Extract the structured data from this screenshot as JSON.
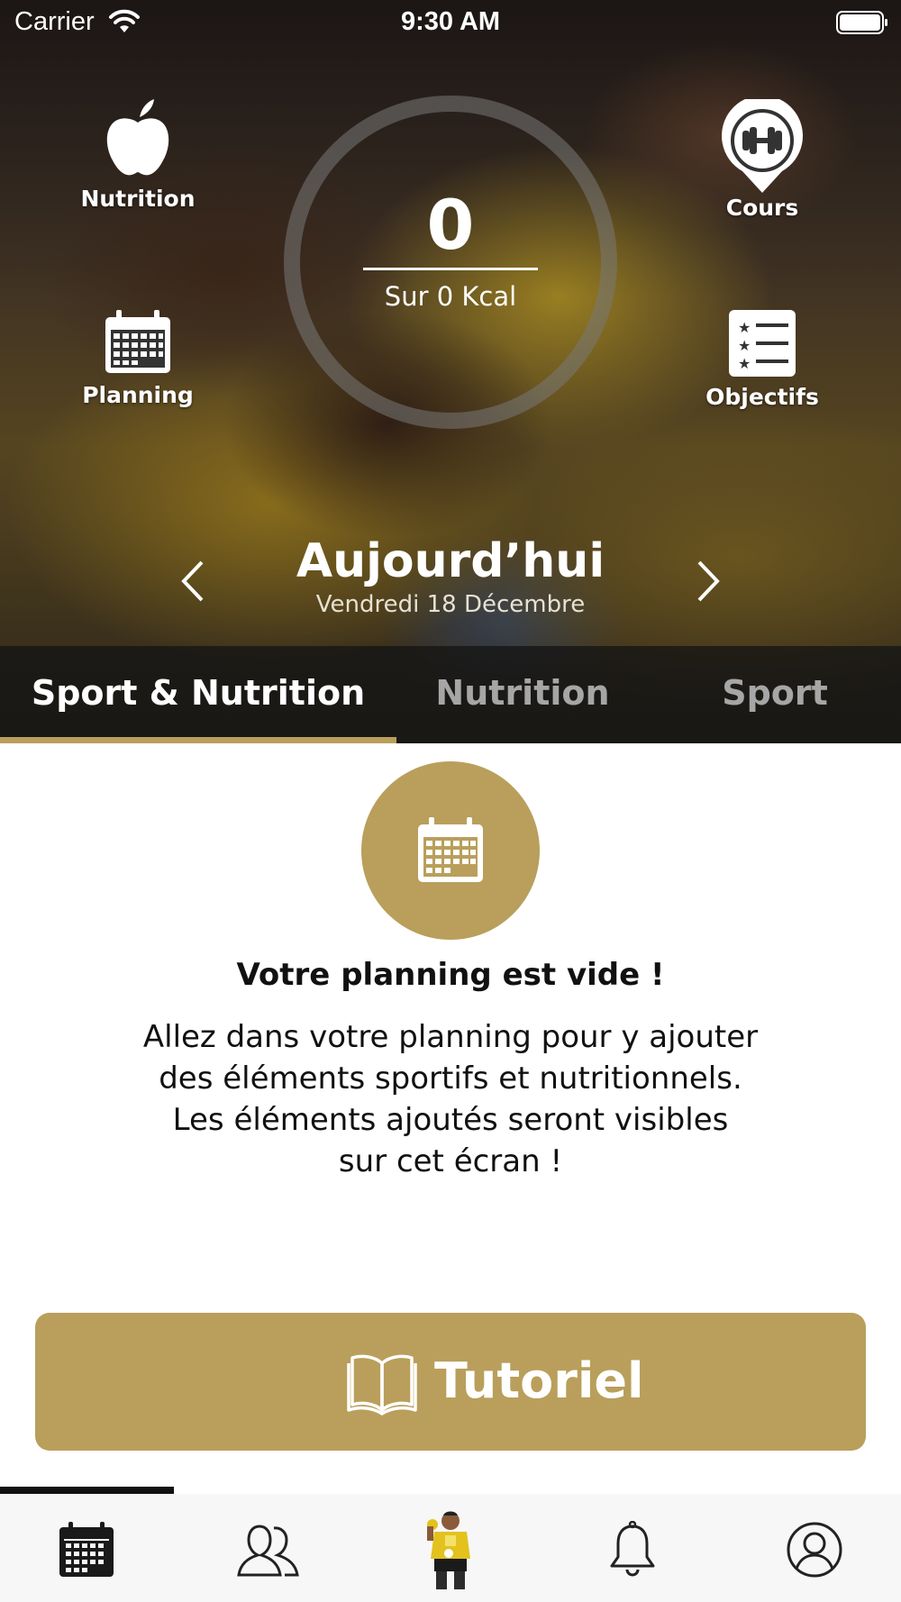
{
  "status_bar": {
    "carrier": "Carrier",
    "time": "9:30 AM"
  },
  "quick_actions": {
    "nutrition": "Nutrition",
    "cours": "Cours",
    "planning": "Planning",
    "objectifs": "Objectifs"
  },
  "calories": {
    "value": "0",
    "subtitle": "Sur 0 Kcal"
  },
  "date_nav": {
    "title": "Aujourd’hui",
    "subtitle": "Vendredi 18 Décembre"
  },
  "tabs": [
    {
      "label": "Sport & Nutrition",
      "active": true
    },
    {
      "label": "Nutrition",
      "active": false
    },
    {
      "label": "Sport",
      "active": false
    }
  ],
  "empty_state": {
    "title": "Votre planning est vide !",
    "line1": "Allez dans votre planning pour y ajouter",
    "line2": "des éléments sportifs et nutritionnels.",
    "line3": "Les éléments ajoutés seront visibles",
    "line4": "sur cet écran !"
  },
  "tutorial_button": {
    "label": "Tutoriel"
  },
  "bottom_nav": [
    {
      "icon": "calendar-icon",
      "active": true
    },
    {
      "icon": "community-icon",
      "active": false
    },
    {
      "icon": "coach-avatar-icon",
      "active": false
    },
    {
      "icon": "bell-icon",
      "active": false
    },
    {
      "icon": "profile-icon",
      "active": false
    }
  ],
  "colors": {
    "accent": "#b99f5b",
    "tab_inactive": "#a6a6a6",
    "tab_bar_bg": "#141414",
    "bottom_bar_bg": "#f7f7f7",
    "text": "#111111"
  }
}
